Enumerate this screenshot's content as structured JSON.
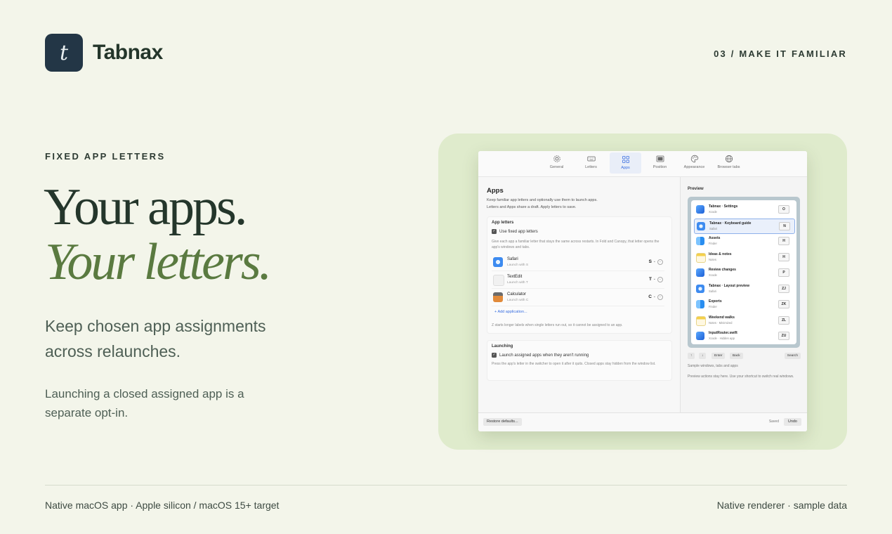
{
  "brand": {
    "mark": "t",
    "name": "Tabnax"
  },
  "step_label": "03 / MAKE IT FAMILIAR",
  "hero": {
    "eyebrow": "FIXED APP LETTERS",
    "line1": "Your apps.",
    "line2": "Your letters.",
    "lead": "Keep chosen app assignments across relaunches.",
    "note": "Launching a closed assigned app is a separate opt-in."
  },
  "footer": {
    "left": "Native macOS app · Apple silicon / macOS 15+ target",
    "right": "Native renderer · sample data"
  },
  "colors": {
    "background": "#f3f5ea",
    "accent_green": "#5a7a40",
    "brand_mark": "#233646",
    "stage": "#dfebcc",
    "link_blue": "#3a6fe0"
  },
  "settings_window": {
    "tabs": [
      {
        "label": "General",
        "icon": "gear-icon"
      },
      {
        "label": "Letters",
        "icon": "keyboard-icon"
      },
      {
        "label": "Apps",
        "icon": "grid-icon",
        "active": true
      },
      {
        "label": "Position",
        "icon": "window-icon"
      },
      {
        "label": "Appearance",
        "icon": "palette-icon"
      },
      {
        "label": "Browser tabs",
        "icon": "globe-icon"
      }
    ],
    "apps_pane": {
      "title": "Apps",
      "desc1": "Keep familiar app letters and optionally use them to launch apps.",
      "desc2": "Letters and Apps share a draft. Apply letters to save.",
      "app_letters_card": {
        "title": "App letters",
        "checkbox_label": "Use fixed app letters",
        "help": "Give each app a familiar letter that stays the same across restarts. In Fold and Canopy, that letter opens the app's windows and tabs.",
        "apps": [
          {
            "name": "Safari",
            "sub": "Launch with S",
            "key": "S",
            "icon": "safari-icon"
          },
          {
            "name": "TextEdit",
            "sub": "Launch with T",
            "key": "T",
            "icon": "textedit-icon"
          },
          {
            "name": "Calculator",
            "sub": "Launch with C",
            "key": "C",
            "icon": "calculator-icon"
          }
        ],
        "add_label": "Add application...",
        "footnote": "Z starts longer labels when single letters run out, so it cannot be assigned to an app."
      },
      "launching_card": {
        "title": "Launching",
        "checkbox_label": "Launch assigned apps when they aren't running",
        "help": "Press the app's letter in the switcher to open it after it quits. Closed apps stay hidden from the window list."
      }
    },
    "preview_pane": {
      "title": "Preview",
      "items": [
        {
          "name": "Tabnax · Settings",
          "sub": "Xcode",
          "key": "O",
          "icon": "xcode-icon"
        },
        {
          "name": "Tabnax · Keyboard guide",
          "sub": "Safari",
          "key": "N",
          "icon": "safari-icon",
          "selected": true
        },
        {
          "name": "Assets",
          "sub": "Finder",
          "key": "H",
          "icon": "finder-icon"
        },
        {
          "name": "Ideas & notes",
          "sub": "Notes",
          "key": "H",
          "icon": "notes-icon"
        },
        {
          "name": "Review changes",
          "sub": "Xcode",
          "key": "P",
          "icon": "xcode-icon"
        },
        {
          "name": "Tabnax · Layout preview",
          "sub": "Safari",
          "key": "ZJ",
          "icon": "safari-icon"
        },
        {
          "name": "Exports",
          "sub": "Finder",
          "key": "ZK",
          "icon": "finder-icon"
        },
        {
          "name": "Weekend walks",
          "sub": "Notes · Minimized",
          "key": "ZL",
          "icon": "notes-icon"
        },
        {
          "name": "InputRouter.swift",
          "sub": "Xcode · Hidden app",
          "key": "ZU",
          "icon": "xcode-icon"
        }
      ],
      "controls": {
        "up": "↑",
        "down": "↓",
        "enter": "Enter",
        "back": "Back",
        "search": "Search"
      },
      "sample_note": "Sample windows, tabs and apps",
      "actions_note": "Preview actions stay here. Use your shortcut to switch real windows."
    },
    "bottom": {
      "restore": "Restore defaults...",
      "saved": "Saved",
      "undo": "Undo"
    }
  }
}
